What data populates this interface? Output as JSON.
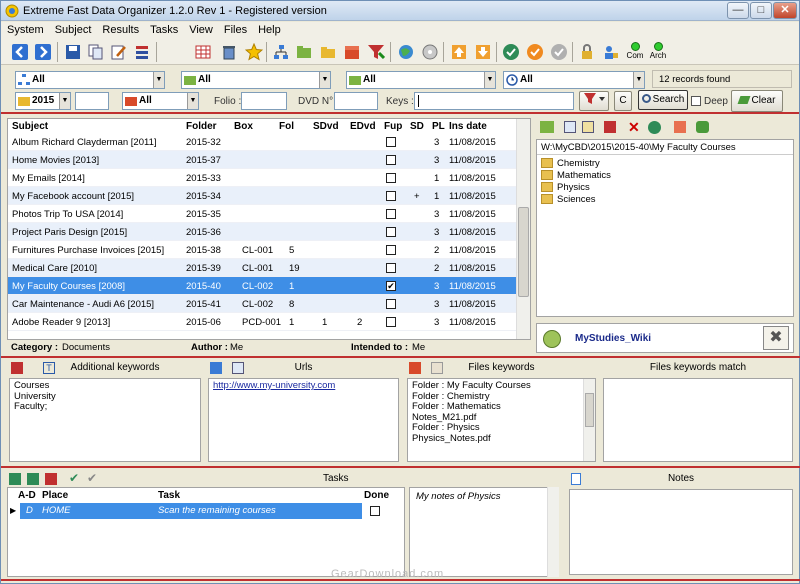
{
  "title": "Extreme Fast Data Organizer 1.2.0 Rev 1 - Registered version",
  "window_buttons": {
    "minimize": "—",
    "maximize": "□",
    "close": "✕"
  },
  "menu": [
    "System",
    "Subject",
    "Results",
    "Tasks",
    "View",
    "Files",
    "Help"
  ],
  "toolbar_right": {
    "com": "Com",
    "arch": "Arch"
  },
  "filters": {
    "combo1": "All",
    "combo2": "All",
    "combo3": "All",
    "combo4": "All",
    "year": "2015",
    "combo6": "All",
    "folio_label": "Folio :",
    "dvd_label": "DVD N° :",
    "keys_label": "Keys :",
    "c_button": "C",
    "search_button": "Search",
    "deep_label": "Deep",
    "clear_button": "Clear",
    "records_found": "12 records found"
  },
  "grid": {
    "columns": [
      "Subject",
      "Folder",
      "Box",
      "Fol",
      "SDvd",
      "EDvd",
      "Fup",
      "SD",
      "PL",
      "Ins date"
    ],
    "rows": [
      {
        "subject": "Album Richard Clayderman [2011]",
        "folder": "2015-32",
        "box": "",
        "fol": "",
        "sdvd": "",
        "edvd": "",
        "fup": false,
        "sd": "",
        "pl": "3",
        "date": "11/08/2015"
      },
      {
        "subject": "Home Movies [2013]",
        "folder": "2015-37",
        "box": "",
        "fol": "",
        "sdvd": "",
        "edvd": "",
        "fup": false,
        "sd": "",
        "pl": "3",
        "date": "11/08/2015"
      },
      {
        "subject": "My Emails [2014]",
        "folder": "2015-33",
        "box": "",
        "fol": "",
        "sdvd": "",
        "edvd": "",
        "fup": false,
        "sd": "",
        "pl": "1",
        "date": "11/08/2015"
      },
      {
        "subject": "My Facebook account [2015]",
        "folder": "2015-34",
        "box": "",
        "fol": "",
        "sdvd": "",
        "edvd": "",
        "fup": false,
        "sd": "+",
        "pl": "1",
        "date": "11/08/2015"
      },
      {
        "subject": "Photos Trip To USA [2014]",
        "folder": "2015-35",
        "box": "",
        "fol": "",
        "sdvd": "",
        "edvd": "",
        "fup": false,
        "sd": "",
        "pl": "3",
        "date": "11/08/2015"
      },
      {
        "subject": "Project Paris Design [2015]",
        "folder": "2015-36",
        "box": "",
        "fol": "",
        "sdvd": "",
        "edvd": "",
        "fup": false,
        "sd": "",
        "pl": "3",
        "date": "11/08/2015"
      },
      {
        "subject": "Furnitures Purchase Invoices [2015]",
        "folder": "2015-38",
        "box": "CL-001",
        "fol": "5",
        "sdvd": "",
        "edvd": "",
        "fup": false,
        "sd": "",
        "pl": "2",
        "date": "11/08/2015"
      },
      {
        "subject": "Medical Care [2010]",
        "folder": "2015-39",
        "box": "CL-001",
        "fol": "19",
        "sdvd": "",
        "edvd": "",
        "fup": false,
        "sd": "",
        "pl": "2",
        "date": "11/08/2015"
      },
      {
        "subject": "My Faculty Courses [2008]",
        "folder": "2015-40",
        "box": "CL-002",
        "fol": "1",
        "sdvd": "",
        "edvd": "",
        "fup": true,
        "sd": "",
        "pl": "3",
        "date": "11/08/2015"
      },
      {
        "subject": "Car Maintenance - Audi A6 [2015]",
        "folder": "2015-41",
        "box": "CL-002",
        "fol": "8",
        "sdvd": "",
        "edvd": "",
        "fup": false,
        "sd": "",
        "pl": "3",
        "date": "11/08/2015"
      },
      {
        "subject": "Adobe Reader 9 [2013]",
        "folder": "2015-06",
        "box": "PCD-001",
        "fol": "1",
        "sdvd": "1",
        "edvd": "2",
        "fup": false,
        "sd": "",
        "pl": "3",
        "date": "11/08/2015"
      }
    ]
  },
  "details": {
    "category_label": "Category :",
    "category_value": "Documents",
    "author_label": "Author :",
    "author_value": "Me",
    "intended_label": "Intended to :",
    "intended_value": "Me"
  },
  "folders": {
    "path": "W:\\MyCBD\\2015\\2015-40\\My Faculty Courses",
    "items": [
      "Chemistry",
      "Mathematics",
      "Physics",
      "Sciences"
    ],
    "wiki": "MyStudies_Wiki"
  },
  "panes": {
    "keywords_title": "Additional keywords",
    "keywords": [
      "Courses",
      "University",
      "Faculty;"
    ],
    "urls_title": "Urls",
    "url": "http://www.my-university.com",
    "files_title": "Files keywords",
    "files": [
      "Folder : My Faculty Courses",
      "Folder : Chemistry",
      "Folder : Mathematics",
      "Notes_M21.pdf",
      "Folder : Physics",
      "Physics_Notes.pdf"
    ],
    "match_title": "Files keywords match"
  },
  "tasks": {
    "title": "Tasks",
    "columns": [
      "A-D",
      "Place",
      "Task",
      "Done"
    ],
    "rows": [
      {
        "ad": "D",
        "place": "HOME",
        "task": "Scan the remaining courses",
        "done": false
      }
    ],
    "notes_text": "My notes of Physics",
    "notes_title": "Notes"
  },
  "watermark": "GearDownload.com"
}
